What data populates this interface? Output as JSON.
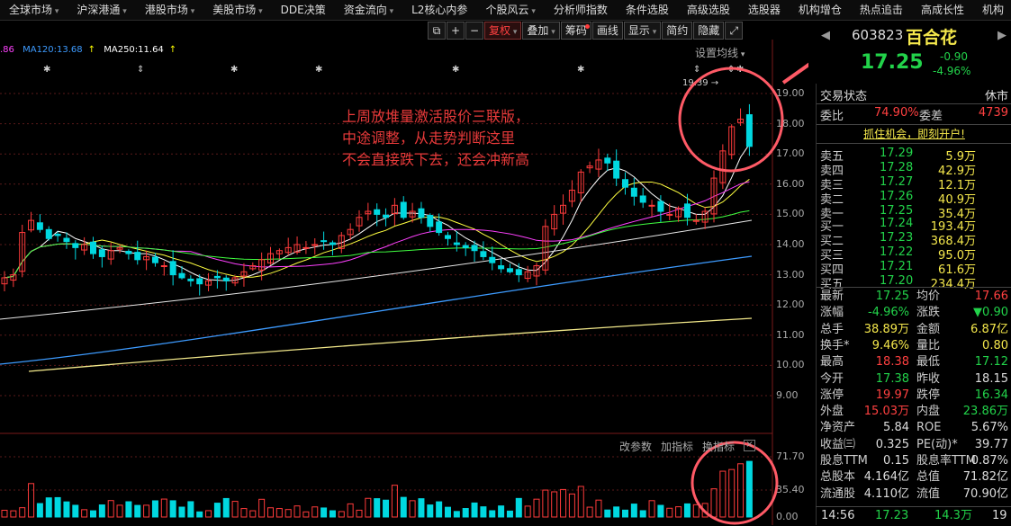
{
  "menu": {
    "items": [
      {
        "label": "全球市场",
        "dd": true
      },
      {
        "label": "沪深港通",
        "dd": true
      },
      {
        "label": "港股市场",
        "dd": true
      },
      {
        "label": "美股市场",
        "dd": true
      },
      {
        "label": "DDE决策",
        "dd": false
      },
      {
        "label": "资金流向",
        "dd": true
      },
      {
        "label": "L2核心内参",
        "dd": false
      },
      {
        "label": "个股风云",
        "dd": true
      },
      {
        "label": "分析师指数",
        "dd": false
      },
      {
        "label": "条件选股",
        "dd": false
      },
      {
        "label": "高级选股",
        "dd": false
      },
      {
        "label": "选股器",
        "dd": false
      },
      {
        "label": "机构增仓",
        "dd": false
      },
      {
        "label": "热点追击",
        "dd": false
      },
      {
        "label": "高成长性",
        "dd": false
      },
      {
        "label": "机构",
        "dd": false
      }
    ]
  },
  "toolbar": {
    "fuquan": "复权",
    "diejia": "叠加",
    "chouma": "筹码",
    "huaxian": "画线",
    "xianshi": "显示",
    "jianyue": "简约",
    "yincang": "隐藏"
  },
  "ma_legend": {
    "cut": ".86",
    "ma120": "MA120:13.68",
    "ma250": "MA250:11.64",
    "set_label": "设置均线"
  },
  "price_axis": [
    "19.00",
    "18.00",
    "17.00",
    "16.00",
    "15.00",
    "14.00",
    "13.00",
    "12.00",
    "11.00",
    "10.00",
    "9.00"
  ],
  "vol_axis": [
    "71.70",
    "35.40",
    "0.00"
  ],
  "high_marker": "19.39",
  "annotation": [
    "上周放堆量激活股价三联版，",
    "中途调整，从走势判断这里",
    "不会直接跌下去，还会冲新高"
  ],
  "sub_toolbar": {
    "edit": "改参数",
    "add": "加指标",
    "swap": "换指标",
    "close": "×"
  },
  "stock": {
    "code": "603823",
    "name": "百合花",
    "price": "17.25",
    "change": "-0.90",
    "pct": "-4.96%"
  },
  "status": {
    "label": "交易状态",
    "value": "休市"
  },
  "wb": {
    "weibi_label": "委比",
    "weibi": "74.90%",
    "weicha_label": "委差",
    "weicha": "4739"
  },
  "promo": "抓住机会，即刻开户!",
  "sells": [
    {
      "l": "卖五",
      "p": "17.29",
      "v": "5.9万"
    },
    {
      "l": "卖四",
      "p": "17.28",
      "v": "42.9万"
    },
    {
      "l": "卖三",
      "p": "17.27",
      "v": "12.1万"
    },
    {
      "l": "卖二",
      "p": "17.26",
      "v": "40.9万"
    },
    {
      "l": "卖一",
      "p": "17.25",
      "v": "35.4万"
    }
  ],
  "buys": [
    {
      "l": "买一",
      "p": "17.24",
      "v": "193.4万"
    },
    {
      "l": "买二",
      "p": "17.23",
      "v": "368.4万"
    },
    {
      "l": "买三",
      "p": "17.22",
      "v": "95.0万"
    },
    {
      "l": "买四",
      "p": "17.21",
      "v": "61.6万"
    },
    {
      "l": "买五",
      "p": "17.20",
      "v": "234.4万"
    }
  ],
  "stats": [
    {
      "a": "最新",
      "b": "17.25",
      "bc": "g",
      "c": "均价",
      "d": "17.66",
      "dc": "r"
    },
    {
      "a": "涨幅",
      "b": "-4.96%",
      "bc": "g",
      "c": "涨跌",
      "d": "▼0.90",
      "dc": "g"
    },
    {
      "a": "总手",
      "b": "38.89万",
      "bc": "y",
      "c": "金额",
      "d": "6.87亿",
      "dc": "y"
    },
    {
      "a": "换手*",
      "b": "9.46%",
      "bc": "y",
      "c": "量比",
      "d": "0.80",
      "dc": "y"
    },
    {
      "a": "最高",
      "b": "18.38",
      "bc": "r",
      "c": "最低",
      "d": "17.12",
      "dc": "g"
    },
    {
      "a": "今开",
      "b": "17.38",
      "bc": "g",
      "c": "昨收",
      "d": "18.15",
      "dc": "w"
    },
    {
      "a": "涨停",
      "b": "19.97",
      "bc": "r",
      "c": "跌停",
      "d": "16.34",
      "dc": "g"
    },
    {
      "a": "外盘",
      "b": "15.03万",
      "bc": "r",
      "c": "内盘",
      "d": "23.86万",
      "dc": "g"
    },
    {
      "a": "净资产",
      "b": "5.84",
      "bc": "w",
      "c": "ROE",
      "d": "5.67%",
      "dc": "w"
    },
    {
      "a": "收益㈢",
      "b": "0.325",
      "bc": "w",
      "c": "PE(动)*",
      "d": "39.77",
      "dc": "w"
    },
    {
      "a": "股息TTM",
      "b": "0.15",
      "bc": "w",
      "c": "股息率TTM",
      "d": "0.87%",
      "dc": "w"
    },
    {
      "a": "总股本",
      "b": "4.164亿",
      "bc": "w",
      "c": "总值",
      "d": "71.82亿",
      "dc": "w"
    },
    {
      "a": "流通股",
      "b": "4.110亿",
      "bc": "w",
      "c": "流值",
      "d": "70.90亿",
      "dc": "w"
    }
  ],
  "bottom": {
    "time": "14:56",
    "price": "17.23",
    "vol": "14.3万",
    "n": "19"
  },
  "colors": {
    "up": "#ff3b3b",
    "down": "#00d8e0",
    "ma5": "#ffffff",
    "ma10": "#ffff40",
    "ma20": "#ff40ff",
    "ma60": "#40ff40",
    "ma120": "#3d9bff",
    "ma250": "#f2e88a",
    "circle": "#ff5a66"
  }
}
